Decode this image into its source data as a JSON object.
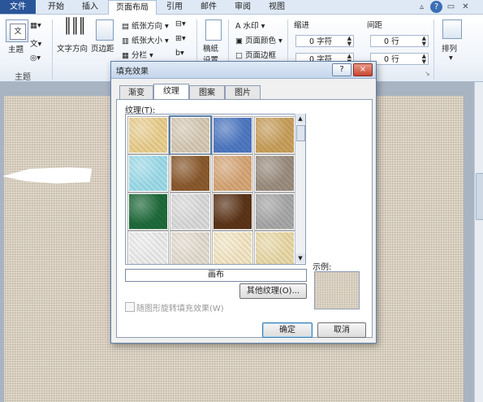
{
  "ribbon_tabs": [
    "文件",
    "开始",
    "插入",
    "页面布局",
    "引用",
    "邮件",
    "审阅",
    "视图"
  ],
  "active_tab": "页面布局",
  "ribbon": {
    "theme_label": "主题",
    "theme_group": "主题",
    "text_dir": "文字方向",
    "margins": "页边距",
    "paper_dir": "纸张方向",
    "paper_size": "纸张大小",
    "columns": "分栏",
    "draft": "稿纸",
    "draft2": "设置",
    "watermark": "水印",
    "page_color": "页面颜色",
    "page_border": "页面边框",
    "indent_title": "缩进",
    "spacing_title": "间距",
    "indent_left": "0 字符",
    "indent_right": "0 字符",
    "spacing_before": "0 行",
    "spacing_after": "0 行",
    "arrange": "排列"
  },
  "dialog": {
    "title": "填充效果",
    "help": "?",
    "close": "×",
    "tabs": [
      "渐变",
      "纹理",
      "图案",
      "图片"
    ],
    "active_tab": "纹理",
    "texture_label": "纹理(T):",
    "selected_name": "画布",
    "other_texture": "其他纹理(O)...",
    "sample_label": "示例:",
    "rotate_label": "随图形旋转填充效果(W)",
    "ok": "确定",
    "cancel": "取消"
  },
  "textures": [
    {
      "name": "tile-1",
      "color": "#e9cf90"
    },
    {
      "name": "tile-2",
      "color": "#d7cbb6"
    },
    {
      "name": "tile-3",
      "color": "#4f79c2"
    },
    {
      "name": "tile-4",
      "color": "#c9a15e"
    },
    {
      "name": "tile-5",
      "color": "#9fdcea"
    },
    {
      "name": "tile-6",
      "color": "#8b5a2e"
    },
    {
      "name": "tile-7",
      "color": "#d6a778"
    },
    {
      "name": "tile-8",
      "color": "#9c8e80"
    },
    {
      "name": "tile-9",
      "color": "#1f6b3b"
    },
    {
      "name": "tile-10",
      "color": "#dadada"
    },
    {
      "name": "tile-11",
      "color": "#5c3418"
    },
    {
      "name": "tile-12",
      "color": "#a8a8a8"
    },
    {
      "name": "tile-13",
      "color": "#ececec"
    },
    {
      "name": "tile-14",
      "color": "#e4dcd0"
    },
    {
      "name": "tile-15",
      "color": "#f3e6c4"
    },
    {
      "name": "tile-16",
      "color": "#e9d9a8"
    }
  ],
  "colors": {
    "file_tab": "#2a5699",
    "page_texture": "#d9cfbe",
    "doc_bg": "#a9b4c2"
  }
}
